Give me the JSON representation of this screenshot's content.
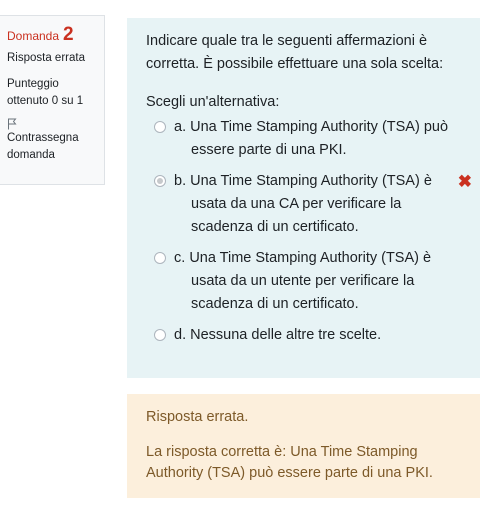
{
  "info": {
    "question_word": "Domanda",
    "question_number": "2",
    "state": "Risposta errata",
    "grade": "Punteggio ottenuto 0 su 1",
    "flag_label": "Contrassegna domanda",
    "flag_icon": "flag-outline-icon"
  },
  "question": {
    "text": "Indicare quale tra le seguenti affermazioni è corretta. È possibile effettuare una sola scelta:",
    "prompt": "Scegli un'alternativa:",
    "options": [
      {
        "letter": "a.",
        "first": "Una Time Stamping Authority (TSA) può",
        "rest": "essere parte di una PKI.",
        "checked": false,
        "incorrect": false
      },
      {
        "letter": "b.",
        "first": "Una Time Stamping Authority (TSA) è",
        "rest": "usata da una CA per verificare la scadenza di un certificato.",
        "checked": true,
        "incorrect": true
      },
      {
        "letter": "c.",
        "first": "Una Time Stamping Authority (TSA) è",
        "rest": "usata da un utente per verificare la scadenza di un certificato.",
        "checked": false,
        "incorrect": false
      },
      {
        "letter": "d.",
        "first": "Nessuna delle altre tre scelte.",
        "rest": "",
        "checked": false,
        "incorrect": false
      }
    ],
    "incorrect_mark": "✖"
  },
  "outcome": {
    "feedback": "Risposta errata.",
    "right_answer": "La risposta corretta è: Una Time Stamping Authority (TSA) può essere parte di una PKI."
  },
  "colors": {
    "danger": "#ca3120",
    "formulation_bg": "#e7f3f5",
    "outcome_bg": "#fcefdc",
    "outcome_text": "#7d5a29"
  }
}
